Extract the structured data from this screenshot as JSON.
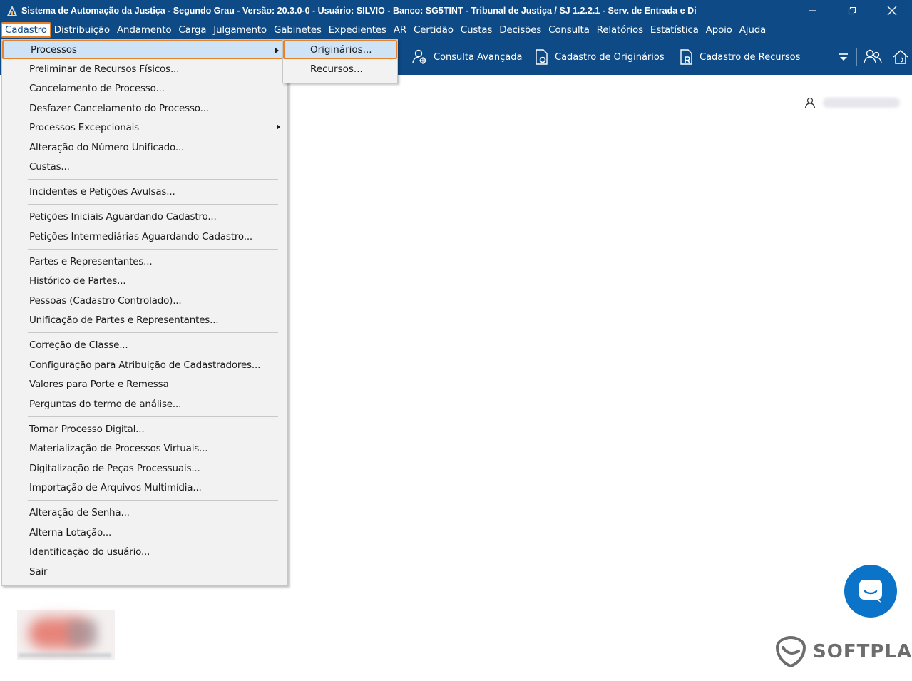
{
  "window": {
    "title": "Sistema de Automação da Justiça - Segundo Grau - Versão: 20.3.0-0 - Usuário: SILVIO - Banco: SG5TINT - Tribunal de Justiça / SJ 1.2.2.1 - Serv. de Entrada e Di",
    "controls": [
      "minimize",
      "restore",
      "close"
    ]
  },
  "menubar": {
    "items": [
      "Cadastro",
      "Distribuição",
      "Andamento",
      "Carga",
      "Julgamento",
      "Gabinetes",
      "Expedientes",
      "AR",
      "Certidão",
      "Custas",
      "Decisões",
      "Consulta",
      "Relatórios",
      "Estatística",
      "Apoio",
      "Ajuda"
    ],
    "active": "Cadastro"
  },
  "toolbar": {
    "consulta_avancada": "Consulta Avançada",
    "cadastro_originarios": "Cadastro de Originários",
    "cadastro_recursos": "Cadastro de Recursos",
    "icons": [
      "filter-icon",
      "users-icon",
      "home-icon"
    ]
  },
  "cadastro_menu": {
    "items": [
      {
        "label": "Processos",
        "submenu": true,
        "highlight": true
      },
      {
        "label": "Preliminar de Recursos Físicos..."
      },
      {
        "label": "Cancelamento de Processo..."
      },
      {
        "label": "Desfazer Cancelamento do Processo..."
      },
      {
        "label": "Processos Excepcionais",
        "submenu": true
      },
      {
        "label": "Alteração do Número Unificado..."
      },
      {
        "label": "Custas..."
      },
      {
        "label": "Incidentes e Petições Avulsas..."
      },
      {
        "label": "Petições Iniciais Aguardando Cadastro..."
      },
      {
        "label": "Petições Intermediárias Aguardando Cadastro..."
      },
      {
        "label": "Partes e Representantes..."
      },
      {
        "label": "Histórico de Partes..."
      },
      {
        "label": "Pessoas (Cadastro Controlado)..."
      },
      {
        "label": "Unificação de Partes e Representantes..."
      },
      {
        "label": "Correção de Classe..."
      },
      {
        "label": "Configuração para Atribuição de Cadastradores..."
      },
      {
        "label": "Valores para Porte e Remessa"
      },
      {
        "label": "Perguntas do termo de análise..."
      },
      {
        "label": "Tornar Processo Digital..."
      },
      {
        "label": "Materialização de Processos Virtuais..."
      },
      {
        "label": "Digitalização de Peças Processuais..."
      },
      {
        "label": "Importação de Arquivos Multimídia..."
      },
      {
        "label": "Alteração de Senha..."
      },
      {
        "label": "Alterna Lotação..."
      },
      {
        "label": "Identificação do usuário..."
      },
      {
        "label": "Sair"
      }
    ]
  },
  "processos_submenu": {
    "items": [
      {
        "label": "Originários...",
        "highlight": true
      },
      {
        "label": "Recursos..."
      }
    ]
  },
  "brand": {
    "name": "SOFTPLAN"
  },
  "colors": {
    "header_blue": "#0d4a86",
    "highlight_orange": "#e8822a",
    "chat_blue": "#0b73c8"
  }
}
